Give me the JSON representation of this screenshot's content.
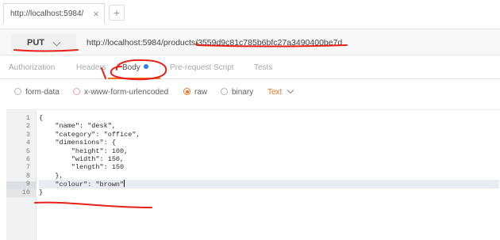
{
  "tab": {
    "title": "http://localhost:5984/",
    "close_glyph": "×",
    "new_glyph": "+"
  },
  "request": {
    "method": "PUT",
    "url": "http://localhost:5984/products/3559d9c81c785b6bfc27a3490400be7d"
  },
  "request_tabs": [
    {
      "label": "Authorization"
    },
    {
      "label": "Headers"
    },
    {
      "label": "Body"
    },
    {
      "label": "Pre-request Script"
    },
    {
      "label": "Tests"
    }
  ],
  "body_types": [
    {
      "label": "form-data"
    },
    {
      "label": "x-www-form-urlencoded"
    },
    {
      "label": "raw"
    },
    {
      "label": "binary"
    }
  ],
  "selected_body_type": "raw",
  "content_type": "Text",
  "editor": {
    "line_numbers": [
      "1",
      "2",
      "3",
      "4",
      "5",
      "6",
      "7",
      "8",
      "9",
      "10"
    ],
    "lines": [
      "{",
      "    \"name\": \"desk\",",
      "    \"category\": \"office\",",
      "    \"dimensions\": {",
      "        \"height\": 100,",
      "        \"width\": 150,",
      "        \"length\": 150",
      "    },",
      "    \"colour\": \"brown\"",
      "}"
    ]
  },
  "colors": {
    "accent": "#f47023",
    "dot": "#2e7cf6",
    "annotation": "#e8201a"
  }
}
